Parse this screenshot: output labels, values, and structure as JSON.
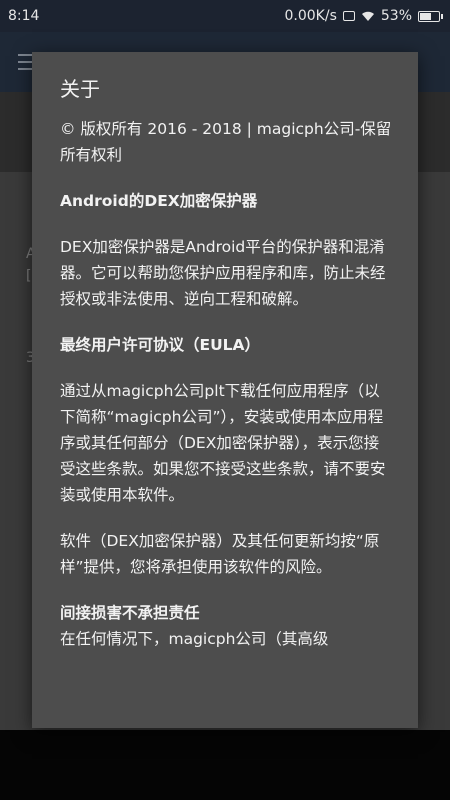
{
  "status_bar": {
    "time": "8:14",
    "network_speed": "0.00K/s",
    "battery_percent": "53%",
    "battery_level": 0.53
  },
  "background": {
    "fragment_1": "A",
    "fragment_2": "[",
    "fragment_3": "3"
  },
  "dialog": {
    "title": "关于",
    "copyright": "© 版权所有 2016 - 2018 | magicph公司-保留所有权利",
    "product_heading": "Android的DEX加密保护器",
    "product_desc": "DEX加密保护器是Android平台的保护器和混淆器。它可以帮助您保护应用程序和库，防止未经授权或非法使用、逆向工程和破解。",
    "eula_heading": "最终用户许可协议（EULA）",
    "eula_p1": "通过从magicph公司plt下载任何应用程序（以下简称“magicph公司”），安装或使用本应用程序或其任何部分（DEX加密保护器），表示您接受这些条款。如果您不接受这些条款，请不要安装或使用本软件。",
    "eula_p2": "软件（DEX加密保护器）及其任何更新均按“原样”提供，您将承担使用该软件的风险。",
    "liability_heading": "间接损害不承担责任",
    "liability_p1": "在任何情况下，magicph公司（其高级"
  }
}
